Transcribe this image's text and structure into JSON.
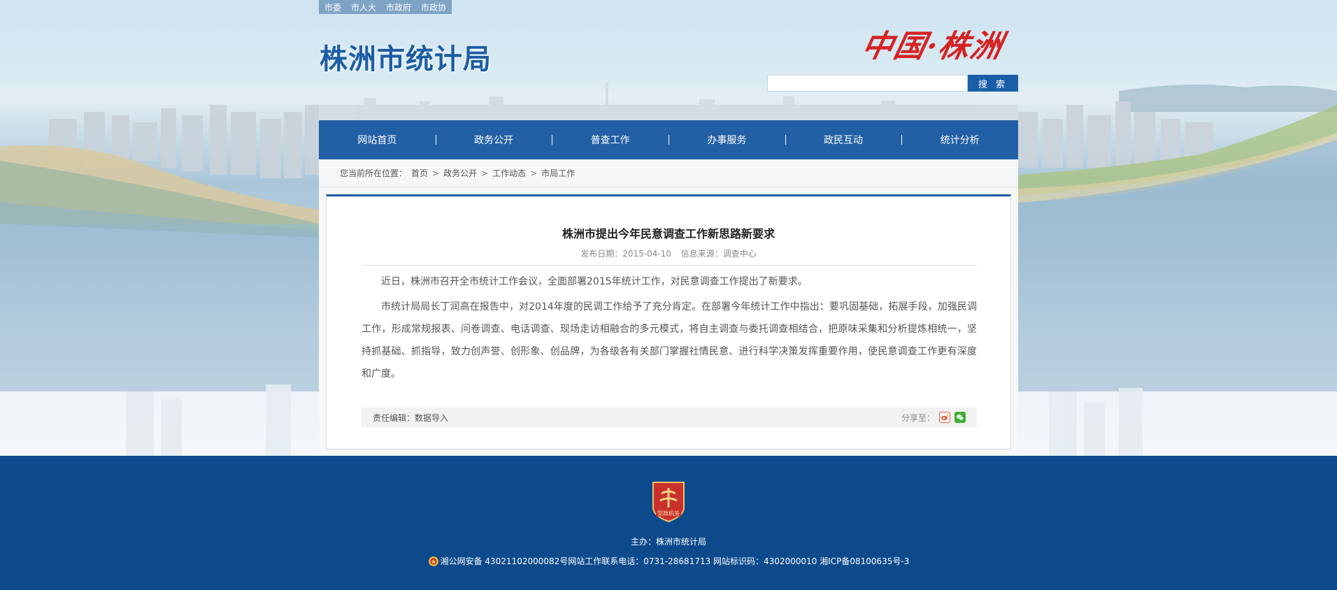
{
  "top_links": [
    "市委",
    "市人大",
    "市政府",
    "市政协"
  ],
  "site": {
    "title": "株洲市统计局",
    "calligraphy": "中国·株洲"
  },
  "search": {
    "placeholder": "",
    "button_label": "搜 索"
  },
  "nav": [
    "网站首页",
    "政务公开",
    "普查工作",
    "办事服务",
    "政民互动",
    "统计分析"
  ],
  "breadcrumb": {
    "prefix": "您当前所在位置：",
    "items": [
      "首页",
      "政务公开",
      "工作动态",
      "市局工作"
    ],
    "separator": ">"
  },
  "article": {
    "title": "株洲市提出今年民意调查工作新思路新要求",
    "publish_date": "发布日期：2015-04-10",
    "source": "信息来源：调查中心",
    "paragraphs": [
      "近日，株洲市召开全市统计工作会议，全面部署2015年统计工作，对民意调查工作提出了新要求。",
      "市统计局局长丁润高在报告中，对2014年度的民调工作给予了充分肯定。在部署今年统计工作中指出：要巩固基础，拓展手段，加强民调工作，形成常规报表、问卷调查、电话调查、现场走访相融合的多元模式，将自主调查与委托调查相结合，把原味采集和分析提炼相统一，坚持抓基础、抓指导，致力创声誉、创形象、创品牌，为各级各有关部门掌握社情民意、进行科学决策发挥重要作用，使民意调查工作更有深度和广度。"
    ],
    "editor": "责任编辑：数据导入",
    "share_label": "分享至："
  },
  "footer": {
    "badge_text": "党政机关",
    "host": "主办：株洲市统计局",
    "record": "湘公网安备 43021102000082号网站工作联系电话：0731-28681713 网站标识码：4302000010 湘ICP备08100635号-3"
  },
  "colors": {
    "nav_bg": "#2260a5",
    "footer_bg": "#0d4a8c",
    "title_blue": "#1c5da4",
    "calligraphy_red": "#d62222"
  }
}
